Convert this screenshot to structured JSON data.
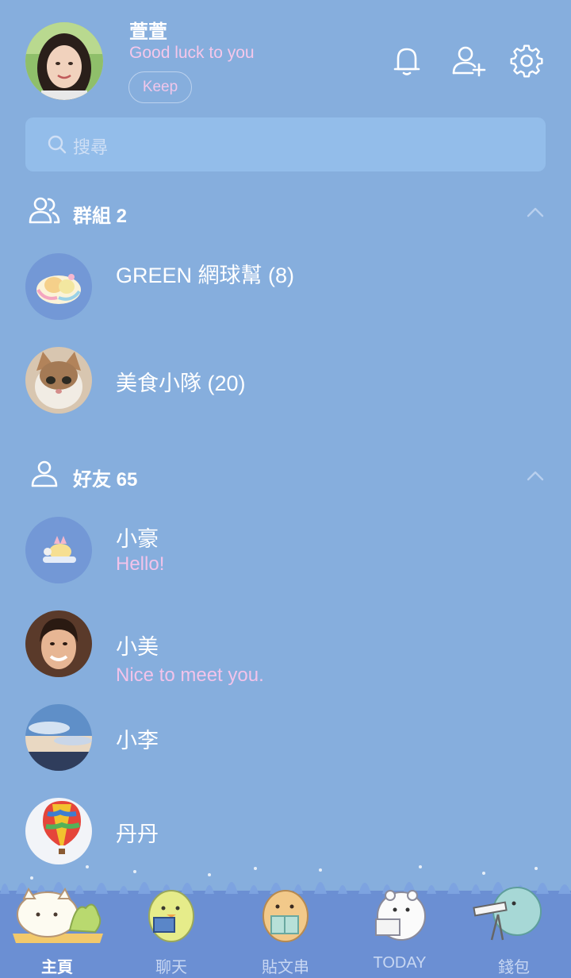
{
  "profile": {
    "name": "萱萱",
    "status": "Good luck to you",
    "keep_label": "Keep"
  },
  "top_icons": [
    "bell-icon",
    "add-friend-icon",
    "gear-icon"
  ],
  "search": {
    "placeholder": "搜尋"
  },
  "groups": {
    "title": "群組 2",
    "items": [
      {
        "name": "GREEN 網球幫 (8)"
      },
      {
        "name": "美食小隊 (20)"
      }
    ]
  },
  "friends": {
    "title": "好友 65",
    "items": [
      {
        "name": "小豪",
        "message": "Hello!"
      },
      {
        "name": "小美",
        "message": "Nice to meet you."
      },
      {
        "name": "小李",
        "message": ""
      },
      {
        "name": "丹丹",
        "message": ""
      }
    ]
  },
  "tabs": [
    {
      "label": "主頁",
      "active": true
    },
    {
      "label": "聊天",
      "active": false
    },
    {
      "label": "貼文串",
      "active": false
    },
    {
      "label": "TODAY",
      "active": false
    },
    {
      "label": "錢包",
      "active": false
    }
  ],
  "colors": {
    "background": "#86aedd",
    "search_bg": "#93bdea",
    "status_pink": "#f5c7ea",
    "tabbar_bg": "#6b8fd3"
  }
}
